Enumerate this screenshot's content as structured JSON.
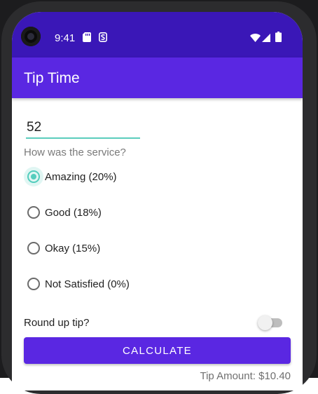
{
  "status_bar": {
    "time": "9:41",
    "icons": [
      "sd-card-icon",
      "s-notification-icon",
      "wifi-icon",
      "cell-signal-icon",
      "battery-icon"
    ]
  },
  "app_bar": {
    "title": "Tip Time"
  },
  "cost_input": {
    "value": "52"
  },
  "service_question": "How was the service?",
  "tip_options": [
    {
      "label": "Amazing (20%)",
      "checked": true
    },
    {
      "label": "Good (18%)",
      "checked": false
    },
    {
      "label": "Okay (15%)",
      "checked": false
    },
    {
      "label": "Not Satisfied (0%)",
      "checked": false
    }
  ],
  "round_up": {
    "label": "Round up tip?",
    "on": false
  },
  "calculate_button": {
    "label": "CALCULATE"
  },
  "tip_result": "Tip Amount: $10.40",
  "colors": {
    "primary": "#5a27e2",
    "status_bar": "#3a17b7",
    "accent": "#54cdbd"
  }
}
